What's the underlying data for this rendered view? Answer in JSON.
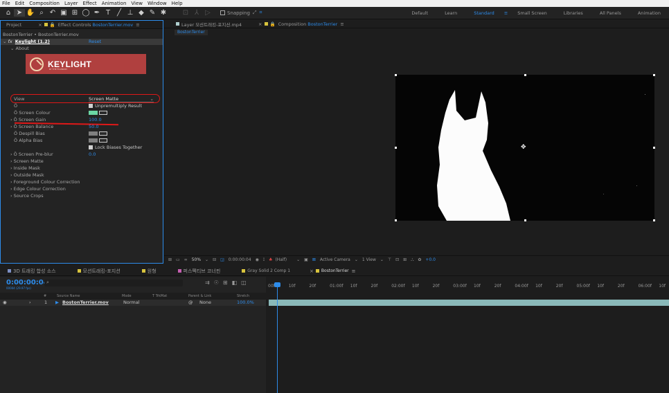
{
  "menubar": [
    "File",
    "Edit",
    "Composition",
    "Layer",
    "Effect",
    "Animation",
    "View",
    "Window",
    "Help"
  ],
  "toolbar": {
    "snapping_label": "Snapping",
    "workspaces": [
      "Default",
      "Learn",
      "Standard",
      "Small Screen",
      "Libraries",
      "All Panels",
      "Animation"
    ],
    "active_workspace": "Standard"
  },
  "left_panel": {
    "tabs": {
      "project": "Project",
      "effect_controls_prefix": "Effect Controls",
      "effect_controls_file": "BostonTerrier.mov"
    },
    "breadcrumb": "BostonTerrier • BostonTerrier.mov",
    "effect": {
      "name": "Keylight (1.2)",
      "reset": "Reset"
    },
    "about_label": "About",
    "logo_text": "KEYLIGHT",
    "logo_subtext": "BY THE FOUNDRY",
    "properties": [
      {
        "label": "View",
        "value": "Screen Matte"
      },
      {
        "label": "",
        "value": "Unpremultiply Result"
      },
      {
        "label": "Screen Colour",
        "value": ""
      },
      {
        "label": "Screen Gain",
        "value": "100.0"
      },
      {
        "label": "Screen Balance",
        "value": "50.0"
      },
      {
        "label": "Despill Bias",
        "value": ""
      },
      {
        "label": "Alpha Bias",
        "value": ""
      },
      {
        "label": "",
        "value": "Lock Biases Together"
      },
      {
        "label": "Screen Pre-blur",
        "value": "0.0"
      }
    ],
    "groups": [
      "Screen Matte",
      "Inside Mask",
      "Outside Mask",
      "Foreground Colour Correction",
      "Edge Colour Correction",
      "Source Crops"
    ]
  },
  "viewer": {
    "tabs": [
      {
        "label": "Layer 모션트래킹-포지션.mp4"
      },
      {
        "label": "Composition",
        "name": "BostonTerrier"
      }
    ],
    "breadcrumb": "BostonTerrier",
    "zoom": "50%",
    "timecode": "0:00:00:04",
    "resolution": "(Half)",
    "camera": "Active Camera",
    "views": "1 View",
    "exposure": "+0.0"
  },
  "bottom": {
    "tabs": [
      "3D 트래킹 합성 소스",
      "모션트래킹-포지션",
      "원형",
      "퍼스펙티브 코너핀",
      "Gray Solid 2 Comp 1",
      "BostonTerrier"
    ],
    "timecode": "0:00:00:04",
    "fps": "00004 (29.97 fps)",
    "columns": {
      "num": "#",
      "source": "Source Name",
      "mode": "Mode",
      "trkmat": "T TrkMat",
      "parent": "Parent & Link",
      "stretch": "Stretch"
    },
    "layer": {
      "num": "1",
      "name": "BostonTerrier.mov",
      "mode": "Normal",
      "parent": "None",
      "stretch": "100.0%"
    },
    "ruler": [
      "00f",
      "10f",
      "20f",
      "01:00f",
      "10f",
      "20f",
      "02:00f",
      "10f",
      "20f",
      "03:00f",
      "10f",
      "20f",
      "04:00f",
      "10f",
      "20f",
      "05:00f",
      "10f",
      "20f",
      "06:00f",
      "10f"
    ]
  },
  "colors": {
    "accent": "#2d8ceb",
    "annotation": "#e01818",
    "logo_bg": "#b0403f",
    "track": "#8ab9b9"
  }
}
